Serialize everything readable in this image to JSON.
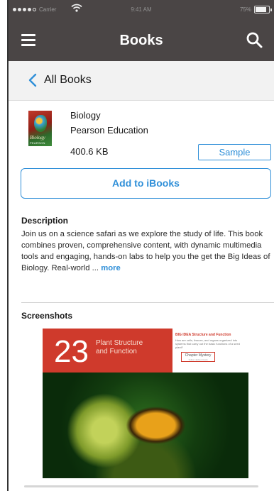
{
  "status_bar": {
    "carrier": "Carrier",
    "time": "9:41 AM",
    "battery": "75%"
  },
  "nav": {
    "title": "Books"
  },
  "back": {
    "label": "All Books"
  },
  "book": {
    "cover_title": "Biology",
    "cover_publisher": "PEARSON",
    "name": "Biology",
    "publisher": "Pearson Education",
    "size": "400.6 KB",
    "sample_label": "Sample"
  },
  "actions": {
    "add_label": "Add to iBooks"
  },
  "description": {
    "heading": "Description",
    "text": "Join us on a science safari as we explore the study of life. This book combines proven, comprehensive content, with dynamic multimedia tools and engaging, hands-on labs to help you the get the Big Ideas of Biology. Real-world ...",
    "more_label": "more"
  },
  "screenshots": {
    "heading": "Screenshots",
    "chapter_number": "23",
    "chapter_title_line1": "Plant Structure",
    "chapter_title_line2": "and Function",
    "panel_heading": "BIG IDEA Structure and Function",
    "panel_text": "How are cells, tissues, and organs organized into systems that carry out the basic functions of a seed plant?",
    "panel_button": "Chapter Mystery",
    "panel_button_sub": "Yellow Jacket Crush"
  },
  "colors": {
    "bar": "#4a4545",
    "accent": "#2f8fd8",
    "chapter_red": "#cf3a2c"
  }
}
